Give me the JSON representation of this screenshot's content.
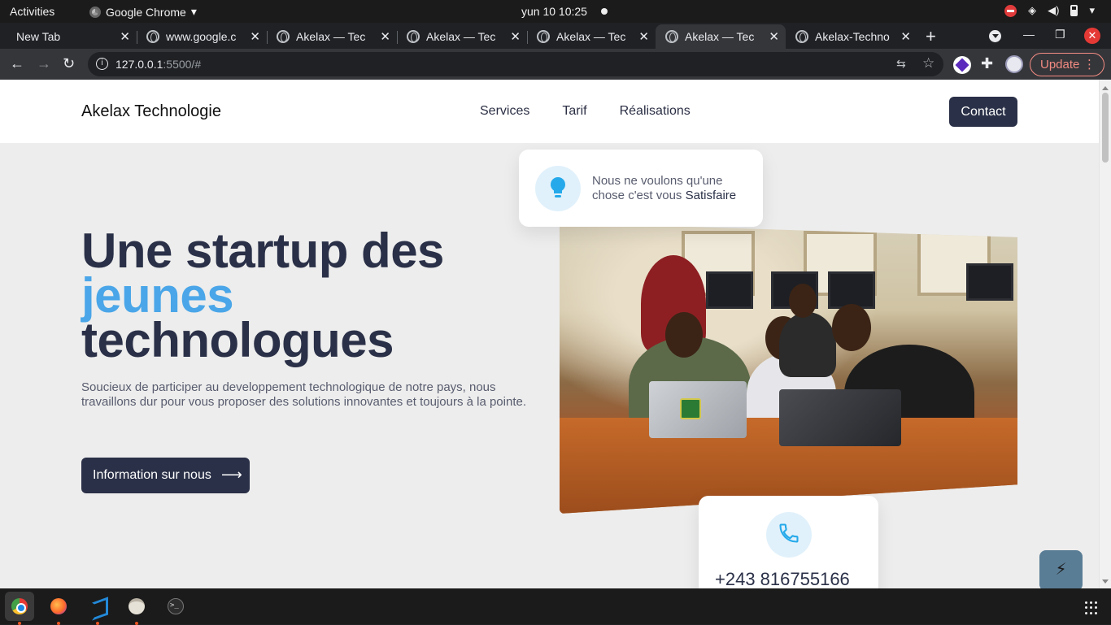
{
  "system": {
    "activities": "Activities",
    "app_name": "Google Chrome",
    "app_menu_arrow": "▾",
    "clock": "yun 10  10:25"
  },
  "browser": {
    "tabs": [
      {
        "title": "New Tab",
        "active": false
      },
      {
        "title": "www.google.c",
        "active": false
      },
      {
        "title": "Akelax — Tec",
        "active": false
      },
      {
        "title": "Akelax — Tec",
        "active": false
      },
      {
        "title": "Akelax — Tec",
        "active": false
      },
      {
        "title": "Akelax — Tec",
        "active": true
      },
      {
        "title": "Akelax-Techno",
        "active": false
      }
    ],
    "tab_close": "✕",
    "new_tab": "+",
    "url_host": "127.0.0.1",
    "url_rest": ":5500/#",
    "update_label": "Update",
    "update_menu": "⋮"
  },
  "site": {
    "logo": "Akelax Technologie",
    "nav": [
      "Services",
      "Tarif",
      "Réalisations"
    ],
    "contact": "Contact",
    "hero": {
      "title_line1": "Une startup des",
      "title_accent": "jeunes",
      "title_line3": "technologues",
      "description": "Soucieux de participer au developpement technologique de notre pays, nous travaillons dur pour vous proposer des solutions innovantes et toujours à la pointe.",
      "cta": "Information sur nous",
      "cta_arrow": "⟶"
    },
    "satisfaction_card": {
      "text": "Nous ne voulons qu'une chose c'est vous",
      "highlight": "Satisfaire"
    },
    "phone_card": {
      "number": "+243 816755166"
    },
    "fab_icon": "⚡"
  },
  "colors": {
    "brand_dark": "#2a3047",
    "accent_blue": "#4aa6e8",
    "icon_blue": "#25a9ea",
    "icon_bg": "#e1f1fb",
    "page_bg": "#ededed"
  },
  "icons": {
    "hero_card": "lightbulb-icon",
    "phone_card": "phone-icon",
    "fab": "lightning-icon"
  }
}
